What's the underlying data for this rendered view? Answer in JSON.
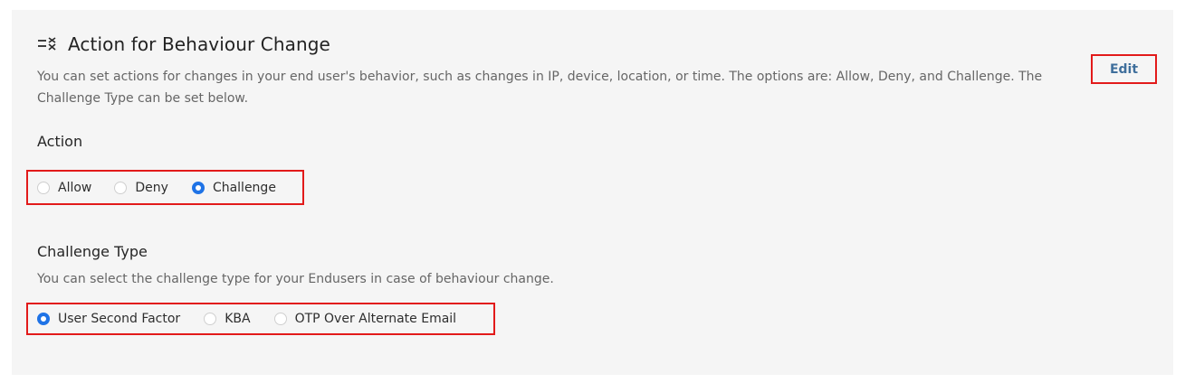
{
  "section": {
    "title": "Action for Behaviour Change",
    "description": "You can set actions for changes in your end user's behavior, such as changes in IP, device, location, or time. The options are: Allow, Deny, and Challenge. The Challenge Type can be set below.",
    "edit_label": "Edit",
    "icon": "list-check-icon"
  },
  "action": {
    "label": "Action",
    "options": [
      {
        "label": "Allow",
        "selected": false
      },
      {
        "label": "Deny",
        "selected": false
      },
      {
        "label": "Challenge",
        "selected": true
      }
    ]
  },
  "challenge_type": {
    "label": "Challenge Type",
    "description": "You can select the challenge type for your Endusers in case of behaviour change.",
    "options": [
      {
        "label": "User Second Factor",
        "selected": true
      },
      {
        "label": "KBA",
        "selected": false
      },
      {
        "label": "OTP Over Alternate Email",
        "selected": false
      }
    ]
  },
  "colors": {
    "accent": "#1f73e6",
    "highlight_border": "#e21a1a",
    "edit_link": "#3f6f9c",
    "panel_bg": "#f5f5f5"
  }
}
